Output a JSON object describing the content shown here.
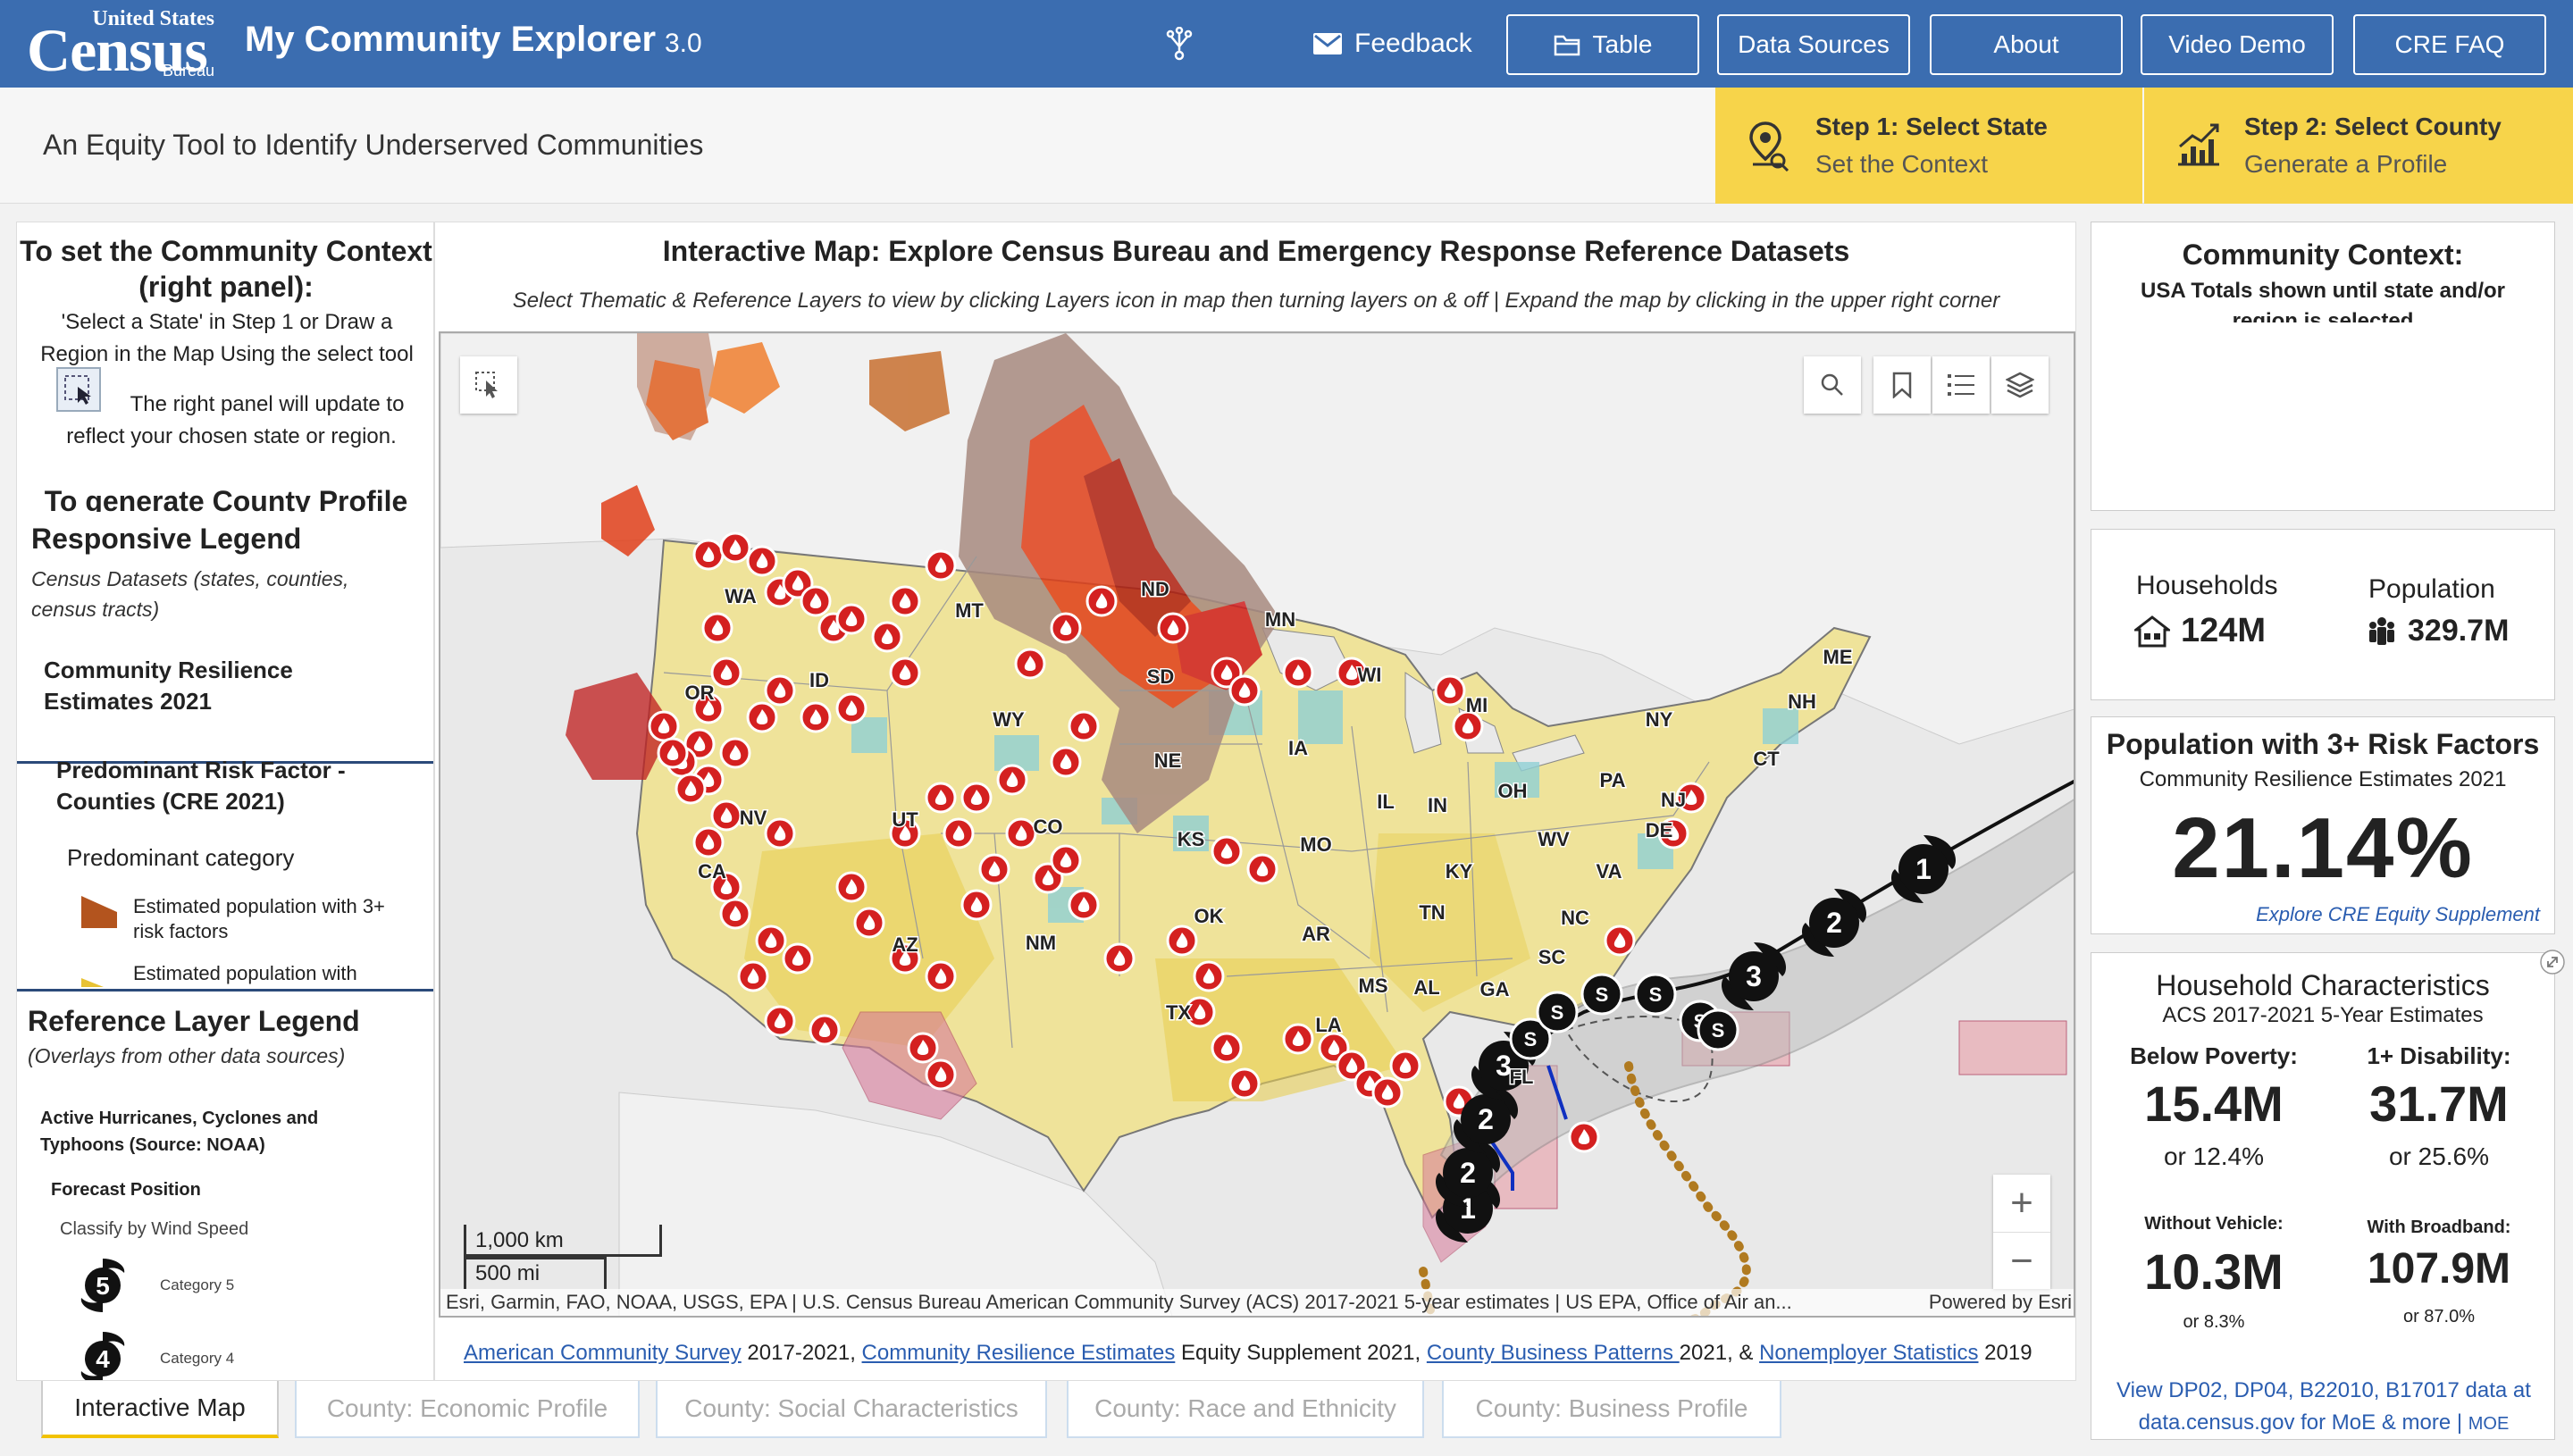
{
  "header": {
    "logo": {
      "line1": "United States",
      "line2": "Census",
      "line3": "Bureau"
    },
    "title": "My Community Explorer",
    "version": "3.0",
    "feedback": "Feedback",
    "buttons": [
      {
        "label": "Table",
        "icon": "folder-icon"
      },
      {
        "label": "Data Sources"
      },
      {
        "label": "About"
      },
      {
        "label": "Video Demo"
      },
      {
        "label": "CRE FAQ"
      }
    ]
  },
  "subheader": {
    "tagline": "An Equity Tool to Identify Underserved Communities",
    "step1": {
      "title": "Step 1: Select State",
      "subtitle": "Set the Context"
    },
    "step2": {
      "title": "Step 2: Select County",
      "subtitle": "Generate a Profile"
    }
  },
  "left": {
    "context_title": "To set the Community Context (right panel):",
    "context_text": "'Select a State' in Step 1 or Draw a Region in the Map Using the select tool",
    "context_text2": "The right panel will update to reflect your chosen state or region.",
    "county_title": "To generate County Profile",
    "responsive_legend": {
      "title": "Responsive Legend",
      "subtitle": "Census Datasets (states, counties, census tracts)",
      "cre": "Community Resilience Estimates 2021",
      "predominant": "Predominant Risk Factor - Counties (CRE 2021)",
      "category": "Predominant category",
      "items": [
        {
          "label": "Estimated population with 3+ risk factors",
          "color": "#b3541e"
        },
        {
          "label": "Estimated population with",
          "color": "#e8c234"
        }
      ]
    },
    "reference_legend": {
      "title": "Reference Layer Legend",
      "subtitle": "(Overlays from other data sources)",
      "hurricanes": "Active Hurricanes, Cyclones and Typhoons (Source: NOAA)",
      "forecast": "Forecast Position",
      "classify": "Classify by Wind Speed",
      "categories": [
        {
          "num": "5",
          "label": "Category 5"
        },
        {
          "num": "4",
          "label": "Category 4"
        }
      ]
    }
  },
  "map": {
    "title": "Interactive Map:  Explore Census Bureau and Emergency Response Reference Datasets",
    "subtitle": "Select Thematic & Reference Layers to view by clicking Layers icon in map then turning layers on & off | Expand the map by clicking in the upper right corner",
    "scale_km": "1,000 km",
    "scale_mi": "500 mi",
    "attribution": "Esri, Garmin, FAO, NOAA, USGS, EPA | U.S. Census Bureau American Community Survey (ACS) 2017-2021 5-year estimates | US EPA, Office of Air an...",
    "powered": "Powered by Esri",
    "states": [
      {
        "abbr": "WA"
      },
      {
        "abbr": "MT"
      },
      {
        "abbr": "ND"
      },
      {
        "abbr": "MN"
      },
      {
        "abbr": "OR"
      },
      {
        "abbr": "ID"
      },
      {
        "abbr": "SD"
      },
      {
        "abbr": "WI"
      },
      {
        "abbr": "MI"
      },
      {
        "abbr": "WY"
      },
      {
        "abbr": "NE"
      },
      {
        "abbr": "IA"
      },
      {
        "abbr": "NV"
      },
      {
        "abbr": "UT"
      },
      {
        "abbr": "CO"
      },
      {
        "abbr": "CA"
      },
      {
        "abbr": "KS"
      },
      {
        "abbr": "MO"
      },
      {
        "abbr": "IL"
      },
      {
        "abbr": "IN"
      },
      {
        "abbr": "OH"
      },
      {
        "abbr": "PA"
      },
      {
        "abbr": "NY"
      },
      {
        "abbr": "ME"
      },
      {
        "abbr": "NH"
      },
      {
        "abbr": "CT"
      },
      {
        "abbr": "NJ"
      },
      {
        "abbr": "DE"
      },
      {
        "abbr": "WV"
      },
      {
        "abbr": "VA"
      },
      {
        "abbr": "KY"
      },
      {
        "abbr": "TN"
      },
      {
        "abbr": "NC"
      },
      {
        "abbr": "SC"
      },
      {
        "abbr": "OK"
      },
      {
        "abbr": "AR"
      },
      {
        "abbr": "AZ"
      },
      {
        "abbr": "NM"
      },
      {
        "abbr": "TX"
      },
      {
        "abbr": "LA"
      },
      {
        "abbr": "MS"
      },
      {
        "abbr": "AL"
      },
      {
        "abbr": "GA"
      },
      {
        "abbr": "FL"
      }
    ],
    "storm_labels": [
      "1",
      "2",
      "2",
      "3",
      "S",
      "S",
      "S",
      "S",
      "S",
      "S",
      "3",
      "2",
      "1"
    ]
  },
  "sources": {
    "acs": "American Community Survey",
    "acs_year": " 2017-2021, ",
    "cre": "Community Resilience Estimates",
    "cre_suffix": "  Equity Supplement 2021, ",
    "cbp": "County Business Patterns ",
    "cbp_year": "2021, & ",
    "nes": "Nonemployer Statistics",
    "nes_year": " 2019"
  },
  "tabs": [
    {
      "label": "Interactive Map",
      "active": true
    },
    {
      "label": "County: Economic Profile",
      "active": false
    },
    {
      "label": "County: Social Characteristics",
      "active": false
    },
    {
      "label": "County: Race and Ethnicity",
      "active": false
    },
    {
      "label": "County: Business Profile",
      "active": false
    }
  ],
  "right": {
    "context_title": "Community Context:",
    "context_text": "USA Totals shown until state and/or region is selected",
    "households_label": "Households",
    "households_value": "124M",
    "population_label": "Population",
    "population_value": "329.7M",
    "risk_title": "Population with 3+ Risk Factors",
    "risk_sub": "Community Resilience Estimates 2021",
    "risk_value": "21.14%",
    "risk_link": "Explore CRE Equity Supplement",
    "hh_title": "Household Characteristics",
    "hh_sub": "ACS 2017-2021 5-Year Estimates",
    "poverty_label": "Below Poverty:",
    "poverty_value": "15.4M",
    "poverty_pct": "or 12.4%",
    "disability_label": "1+ Disability:",
    "disability_value": "31.7M",
    "disability_pct": "or 25.6%",
    "vehicle_label": "Without Vehicle:",
    "vehicle_value": "10.3M",
    "vehicle_pct": "or 8.3%",
    "broadband_label": "With Broadband:",
    "broadband_value": "107.9M",
    "broadband_pct": "or 87.0%",
    "data_link": "View DP02, DP04, B22010, B17017 data at data.census.gov for MoE & more",
    "moe": "MOE"
  },
  "colors": {
    "header": "#3b6db0",
    "step": "#f7d44a",
    "fire": "#d42020",
    "link": "#2a5db0"
  }
}
